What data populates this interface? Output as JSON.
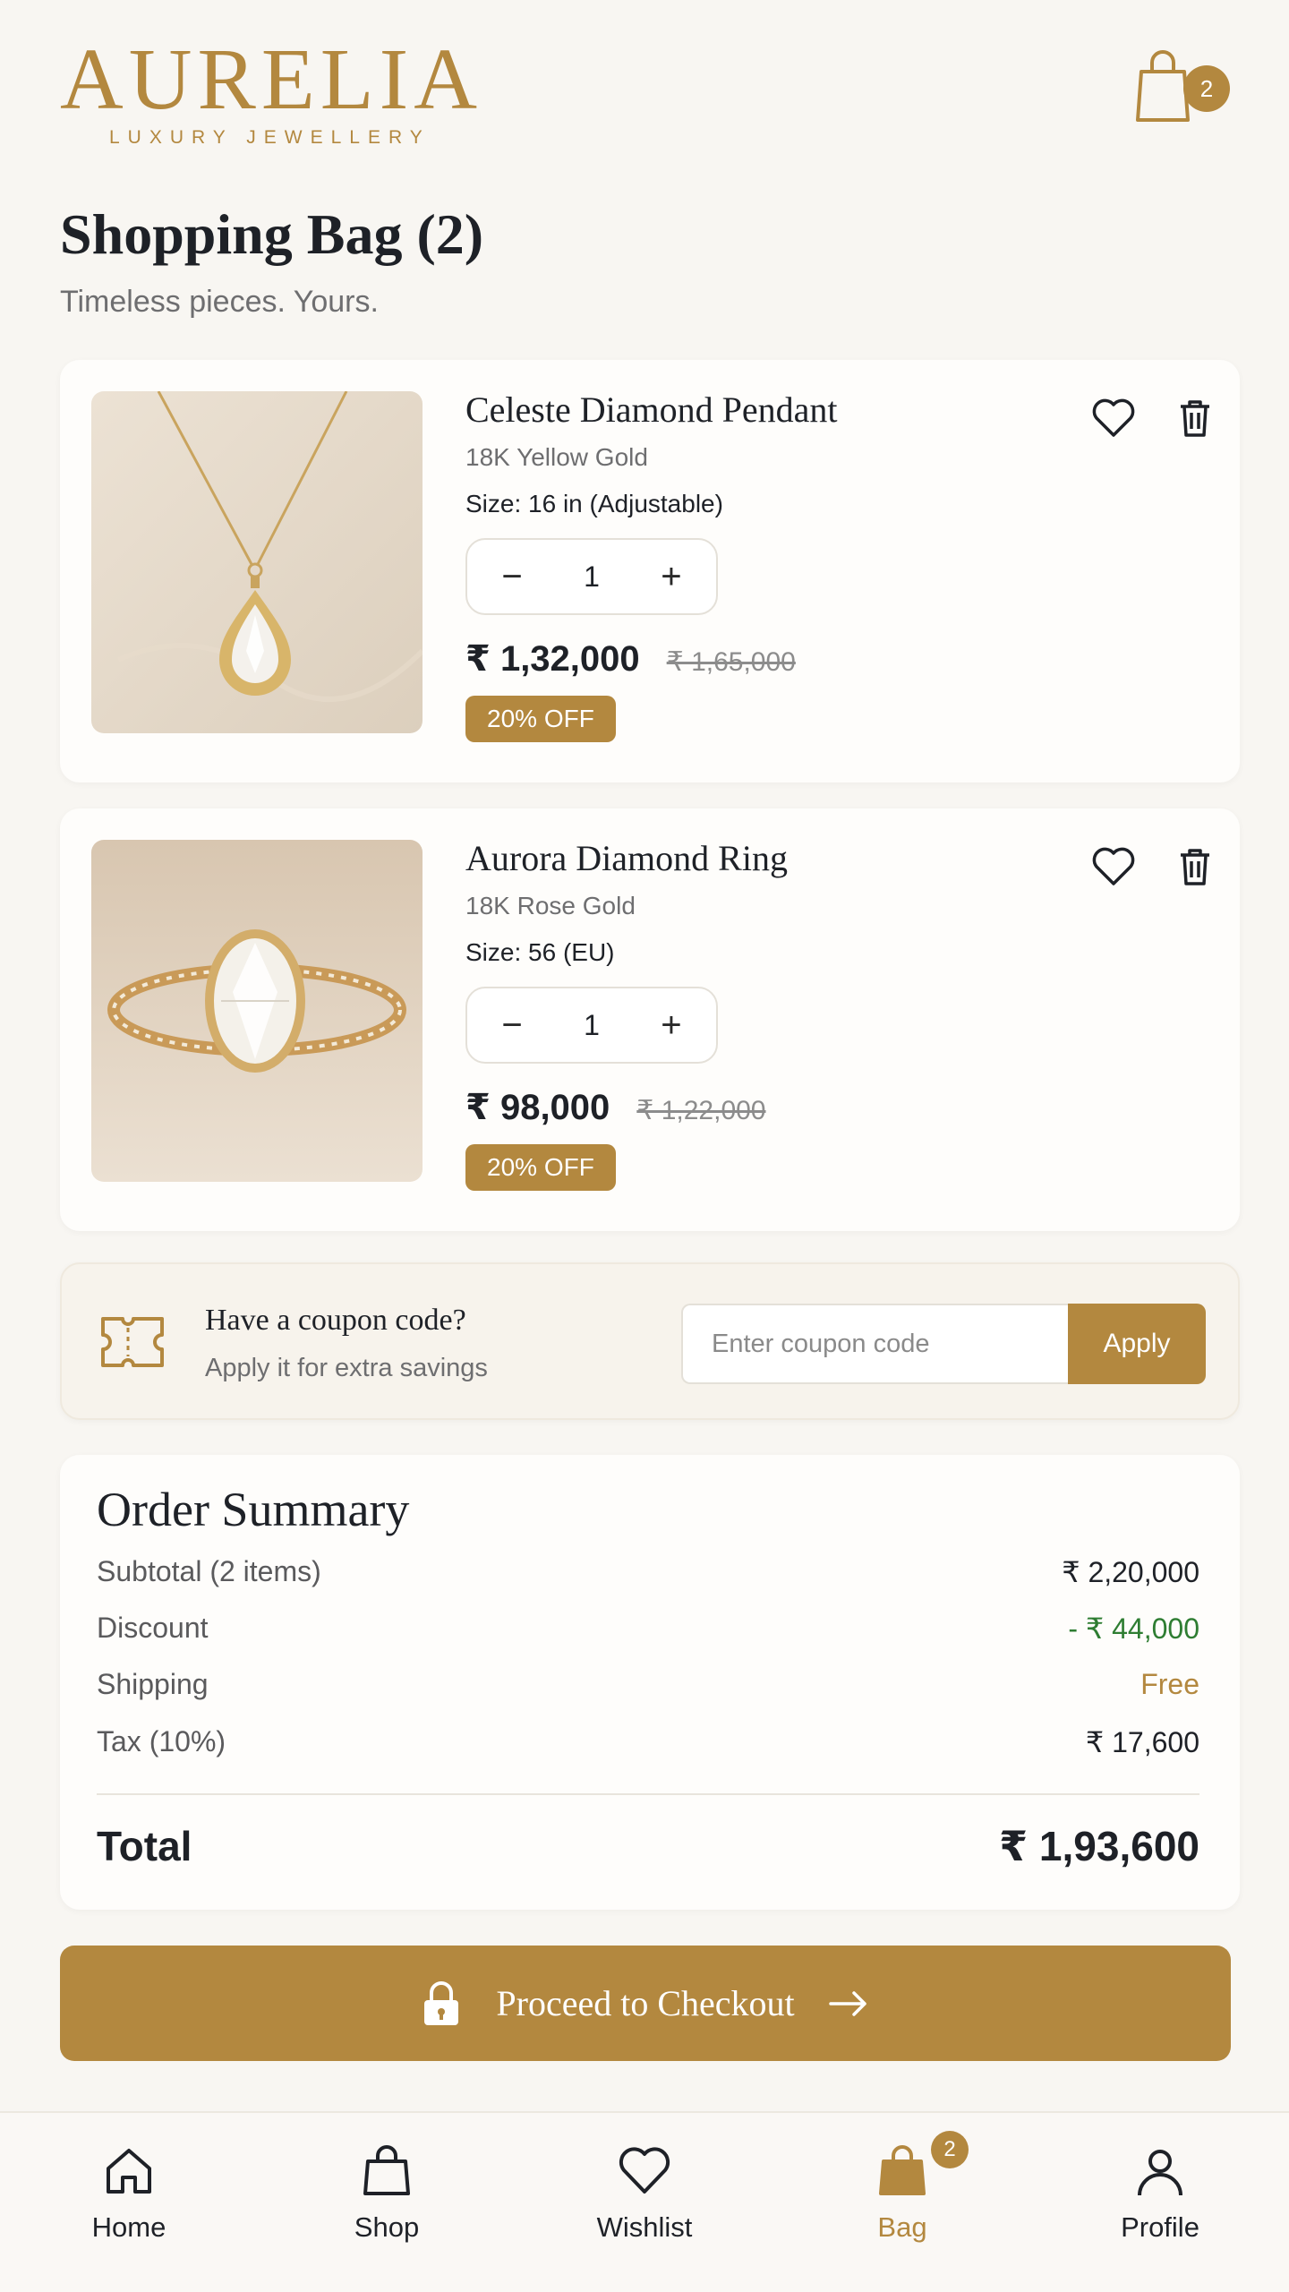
{
  "brand": {
    "name": "AURELIA",
    "tagline": "LUXURY JEWELLERY"
  },
  "header": {
    "bag_count": "2"
  },
  "page": {
    "title": "Shopping Bag (2)",
    "subtitle": "Timeless pieces. Yours."
  },
  "items": [
    {
      "name": "Celeste Diamond Pendant",
      "metal": "18K Yellow Gold",
      "size": "Size: 16 in (Adjustable)",
      "qty": "1",
      "price": "₹ 1,32,000",
      "old_price": "₹ 1,65,000",
      "badge": "20% OFF",
      "image": "pendant-photo"
    },
    {
      "name": "Aurora Diamond Ring",
      "metal": "18K Rose Gold",
      "size": "Size: 56 (EU)",
      "qty": "1",
      "price": "₹ 98,000",
      "old_price": "₹ 1,22,000",
      "badge": "20% OFF",
      "image": "ring-photo"
    }
  ],
  "coupon": {
    "title": "Have a coupon code?",
    "subtitle": "Apply it for extra savings",
    "placeholder": "Enter coupon code",
    "apply_label": "Apply"
  },
  "summary": {
    "title": "Order Summary",
    "rows": [
      {
        "label": "Subtotal (2 items)",
        "value": "₹ 2,20,000"
      },
      {
        "label": "Discount",
        "value": "- ₹ 44,000"
      },
      {
        "label": "Shipping",
        "value": "Free"
      },
      {
        "label": "Tax (10%)",
        "value": "₹ 17,600"
      }
    ],
    "total_label": "Total",
    "total_value": "₹ 1,93,600"
  },
  "checkout": {
    "label": "Proceed to Checkout"
  },
  "nav": {
    "items": [
      {
        "label": "Home",
        "icon": "home-icon"
      },
      {
        "label": "Shop",
        "icon": "shop-bag-icon"
      },
      {
        "label": "Wishlist",
        "icon": "heart-icon"
      },
      {
        "label": "Bag",
        "icon": "bag-icon",
        "badge": "2"
      },
      {
        "label": "Profile",
        "icon": "user-icon"
      }
    ]
  },
  "colors": {
    "accent": "#b3883f",
    "discount": "#2e7d32",
    "background": "#f8f6f2",
    "text": "#1e2127"
  }
}
